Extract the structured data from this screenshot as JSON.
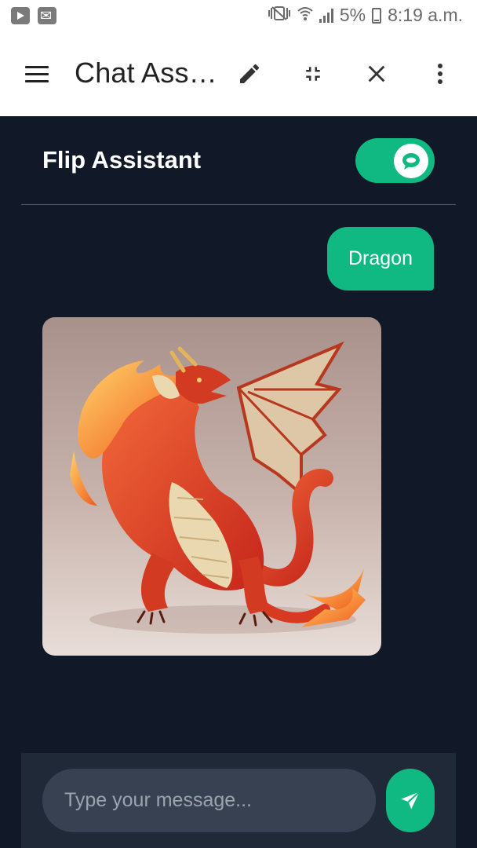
{
  "status_bar": {
    "left_icons": [
      "youtube-notification-icon",
      "mail-notification-icon"
    ],
    "right_icons": [
      "vibrate-mute-icon",
      "wifi-icon",
      "cell-signal-icon",
      "battery-icon"
    ],
    "battery_percent": "5%",
    "time": "8:19 a.m."
  },
  "app_bar": {
    "title": "Chat Ass…",
    "icons": [
      "menu-icon",
      "edit-pencil-icon",
      "minimize-icon",
      "close-icon",
      "more-vert-icon"
    ]
  },
  "chat": {
    "assistant_title": "Flip Assistant",
    "toggle_on": true,
    "messages": [
      {
        "role": "user",
        "text": "Dragon"
      },
      {
        "role": "assistant",
        "type": "image",
        "subject": "dragon-image"
      }
    ]
  },
  "input": {
    "placeholder": "Type your message...",
    "value": ""
  },
  "colors": {
    "accent": "#10b981",
    "background": "#111827",
    "input_area": "#1f2937",
    "input_field": "#374151"
  }
}
